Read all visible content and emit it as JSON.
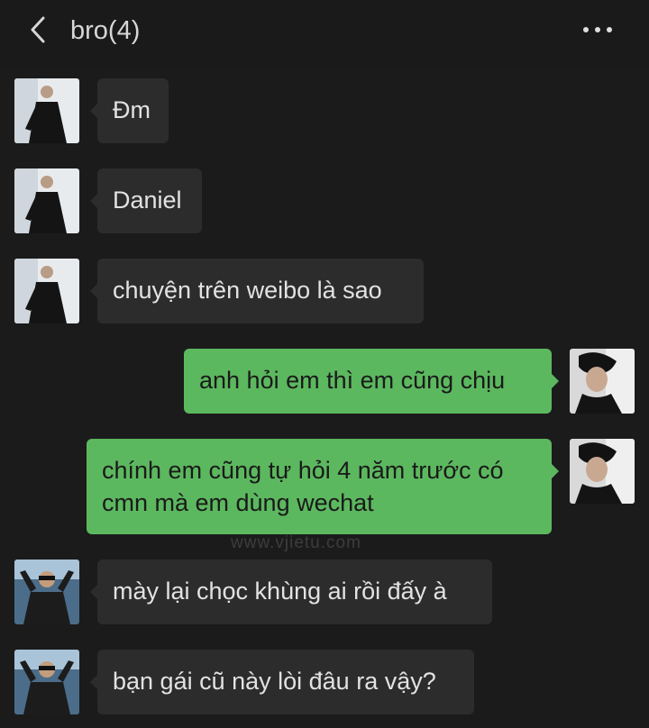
{
  "header": {
    "title": "bro(4)"
  },
  "messages": [
    {
      "side": "left",
      "avatar": "avatar-contact-1",
      "text": "Đm"
    },
    {
      "side": "left",
      "avatar": "avatar-contact-1",
      "text": "Daniel"
    },
    {
      "side": "left",
      "avatar": "avatar-contact-1",
      "text": "chuyện trên weibo là sao"
    },
    {
      "side": "right",
      "avatar": "avatar-self",
      "text": "anh hỏi em thì em cũng chịu"
    },
    {
      "side": "right",
      "avatar": "avatar-self",
      "text": "chính em cũng tự hỏi 4 năm trước có cmn mà em dùng wechat"
    },
    {
      "side": "left",
      "avatar": "avatar-contact-2",
      "text": "mày lại chọc khùng ai rồi đấy à"
    },
    {
      "side": "left",
      "avatar": "avatar-contact-2",
      "text": "bạn gái cũ này lòi đâu ra vậy?"
    }
  ],
  "watermark": {
    "text": "www.vjietu.com"
  },
  "colors": {
    "background": "#1b1b1b",
    "bubble_left": "#2c2c2c",
    "bubble_right": "#5cb85f"
  },
  "icons": [
    "chevron-left-icon",
    "more-dots-icon"
  ]
}
